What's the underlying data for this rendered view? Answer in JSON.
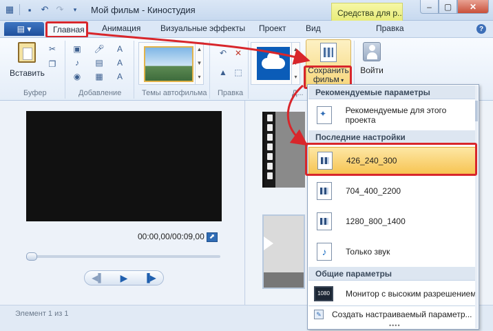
{
  "window": {
    "title": "Мой фильм - Киностудия",
    "context_tab": "Средства для р..."
  },
  "tabs": [
    "Главная",
    "Анимация",
    "Визуальные эффекты",
    "Проект",
    "Вид",
    "Правка"
  ],
  "ribbon": {
    "paste_label": "Вставить",
    "groups": [
      "Буфер",
      "Добавление",
      "Темы автофильма",
      "Правка",
      "Д..."
    ],
    "save_movie_label_1": "Сохранить",
    "save_movie_label_2": "фильм",
    "sign_in_label": "Войти"
  },
  "preview": {
    "timecode": "00:00,00/00:09,00",
    "seek_position": 0
  },
  "status": {
    "text": "Элемент 1 из 1"
  },
  "save_menu": {
    "sections": {
      "recommended": "Рекомендуемые параметры",
      "recent": "Последние настройки",
      "common": "Общие параметры"
    },
    "recommended_item": "Рекомендуемые для этого проекта",
    "recent_items": [
      "426_240_300",
      "704_400_2200",
      "1280_800_1400"
    ],
    "audio_only": "Только звук",
    "monitor_item": "Монитор с высоким разрешением",
    "monitor_badge": "1080",
    "custom_item": "Создать настраиваемый параметр..."
  },
  "colors": {
    "highlight_border": "#d8262b",
    "selected_item": "#f7c453"
  }
}
